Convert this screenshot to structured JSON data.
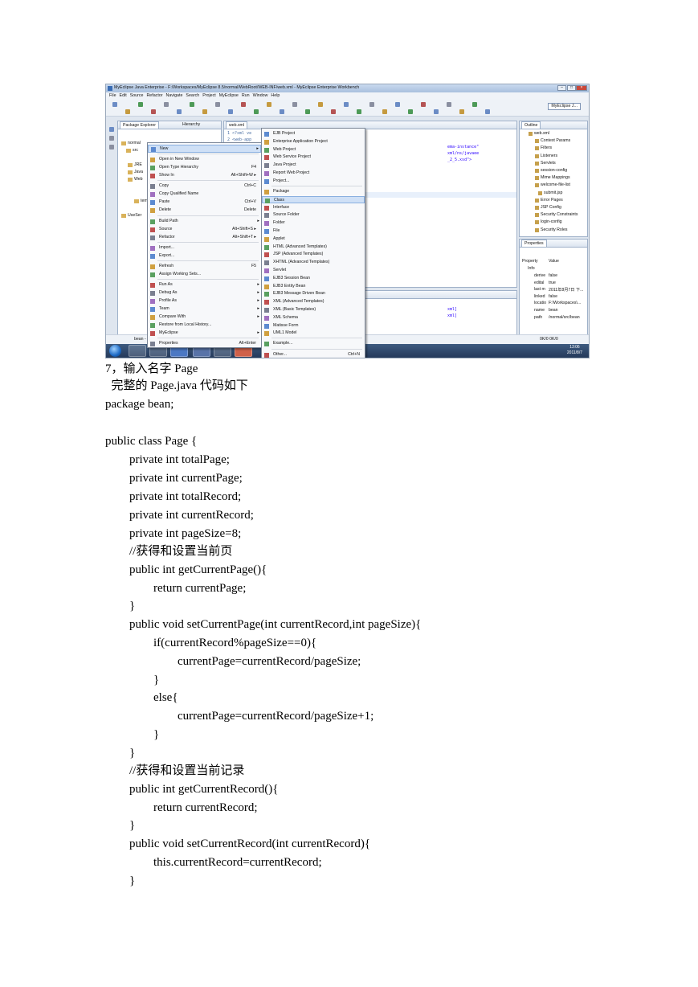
{
  "screenshot": {
    "window_title": "MyEclipse Java Enterprise - F:/Workspaces/MyEclipse 8.5/normal/WebRoot/WEB-INF/web.xml - MyEclipse Enterprise Workbench",
    "menu": [
      "File",
      "Edit",
      "Source",
      "Refactor",
      "Navigate",
      "Search",
      "Project",
      "MyEclipse",
      "Run",
      "Window",
      "Help"
    ],
    "perspective": "MyEclipse J...",
    "explorer_tabs": [
      "Package Explorer",
      "Hierarchy"
    ],
    "explorer_items": [
      "normal",
      "src",
      "JRE",
      "Java",
      "Web",
      "templa",
      "UseSer"
    ],
    "editor_tab": "web.xml",
    "editor_lines": [
      "1  <?xml ve",
      "2  <web-app"
    ],
    "editor_fragments": [
      "ema-instance\"",
      "xml/ns/javaee",
      "_2_5.xsd\">"
    ],
    "console_fragments": [
      "xml]",
      "xml]"
    ],
    "context_menu": [
      {
        "label": "New",
        "shortcut": "",
        "arrow": "▸"
      },
      {
        "label": "Open in New Window",
        "shortcut": ""
      },
      {
        "label": "Open Type Hierarchy",
        "shortcut": "F4"
      },
      {
        "label": "Show In",
        "shortcut": "Alt+Shift+W ▸"
      },
      {
        "label": "Copy",
        "shortcut": "Ctrl+C"
      },
      {
        "label": "Copy Qualified Name",
        "shortcut": ""
      },
      {
        "label": "Paste",
        "shortcut": "Ctrl+V"
      },
      {
        "label": "Delete",
        "shortcut": "Delete"
      },
      {
        "label": "Build Path",
        "shortcut": "",
        "arrow": "▸"
      },
      {
        "label": "Source",
        "shortcut": "Alt+Shift+S ▸"
      },
      {
        "label": "Refactor",
        "shortcut": "Alt+Shift+T ▸"
      },
      {
        "label": "Import...",
        "shortcut": ""
      },
      {
        "label": "Export...",
        "shortcut": ""
      },
      {
        "label": "Refresh",
        "shortcut": "F5"
      },
      {
        "label": "Assign Working Sets...",
        "shortcut": ""
      },
      {
        "label": "Run As",
        "shortcut": "",
        "arrow": "▸"
      },
      {
        "label": "Debug As",
        "shortcut": "",
        "arrow": "▸"
      },
      {
        "label": "Profile As",
        "shortcut": "",
        "arrow": "▸"
      },
      {
        "label": "Team",
        "shortcut": "",
        "arrow": "▸"
      },
      {
        "label": "Compare With",
        "shortcut": "",
        "arrow": "▸"
      },
      {
        "label": "Restore from Local History...",
        "shortcut": ""
      },
      {
        "label": "MyEclipse",
        "shortcut": "",
        "arrow": "▸"
      },
      {
        "label": "Properties",
        "shortcut": "Alt+Enter"
      }
    ],
    "submenu": [
      {
        "label": "EJB Project",
        "shortcut": ""
      },
      {
        "label": "Enterprise Application Project",
        "shortcut": ""
      },
      {
        "label": "Web Project",
        "shortcut": ""
      },
      {
        "label": "Web Service Project",
        "shortcut": ""
      },
      {
        "label": "Java Project",
        "shortcut": ""
      },
      {
        "label": "Report Web Project",
        "shortcut": ""
      },
      {
        "label": "Project...",
        "shortcut": ""
      },
      {
        "label": "Package",
        "shortcut": ""
      },
      {
        "label": "Class",
        "shortcut": ""
      },
      {
        "label": "Interface",
        "shortcut": ""
      },
      {
        "label": "Source Folder",
        "shortcut": ""
      },
      {
        "label": "Folder",
        "shortcut": ""
      },
      {
        "label": "File",
        "shortcut": ""
      },
      {
        "label": "Applet",
        "shortcut": ""
      },
      {
        "label": "HTML (Advanced Templates)",
        "shortcut": ""
      },
      {
        "label": "JSP (Advanced Templates)",
        "shortcut": ""
      },
      {
        "label": "XHTML (Advanced Templates)",
        "shortcut": ""
      },
      {
        "label": "Servlet",
        "shortcut": ""
      },
      {
        "label": "EJB3 Session Bean",
        "shortcut": ""
      },
      {
        "label": "EJB3 Entity Bean",
        "shortcut": ""
      },
      {
        "label": "EJB3 Message Driven Bean",
        "shortcut": ""
      },
      {
        "label": "XML (Advanced Templates)",
        "shortcut": ""
      },
      {
        "label": "XML (Basic Templates)",
        "shortcut": ""
      },
      {
        "label": "XML Schema",
        "shortcut": ""
      },
      {
        "label": "Matisse Form",
        "shortcut": ""
      },
      {
        "label": "UML1 Model",
        "shortcut": ""
      },
      {
        "label": "Example...",
        "shortcut": ""
      },
      {
        "label": "Other...",
        "shortcut": "Ctrl+N"
      }
    ],
    "outline_tab": "Outline",
    "outline_items": [
      "web.xml",
      "Context Params",
      "Filters",
      "Listeners",
      "Servlets",
      "session-config",
      "Mime Mappings",
      "welcome-file-list",
      "submit.jsp",
      "Error Pages",
      "JSP Config",
      "Security Constraints",
      "login-config",
      "Security Roles"
    ],
    "properties_tab": "Properties",
    "properties_headers": [
      "Property",
      "Value"
    ],
    "properties_group": "Info",
    "properties_rows": [
      [
        "derive",
        "false"
      ],
      [
        "edital",
        "true"
      ],
      [
        "last m",
        "2011年8月7日 下..."
      ],
      [
        "linked",
        "false"
      ],
      [
        "locatio",
        "F:\\Workspaces\\..."
      ],
      [
        "name",
        "bean"
      ],
      [
        "path",
        "/normal/src/bean"
      ]
    ],
    "status_left": "bean -",
    "status_right": "0K/0  0K/0",
    "clock_time": "13:06",
    "clock_date": "2011/8/7"
  },
  "document": {
    "lines": [
      "7，输入名字 Page",
      "  完整的 Page.java 代码如下",
      "package bean;",
      "",
      "public class Page {",
      "        private int totalPage;",
      "        private int currentPage;",
      "        private int totalRecord;",
      "        private int currentRecord;",
      "        private int pageSize=8;",
      "        //获得和设置当前页",
      "        public int getCurrentPage(){",
      "                return currentPage;",
      "        }",
      "        public void setCurrentPage(int currentRecord,int pageSize){",
      "                if(currentRecord%pageSize==0){",
      "                        currentPage=currentRecord/pageSize;",
      "                }",
      "                else{",
      "                        currentPage=currentRecord/pageSize+1;",
      "                }",
      "        }",
      "        //获得和设置当前记录",
      "        public int getCurrentRecord(){",
      "                return currentRecord;",
      "        }",
      "        public void setCurrentRecord(int currentRecord){",
      "                this.currentRecord=currentRecord;",
      "        }"
    ]
  }
}
